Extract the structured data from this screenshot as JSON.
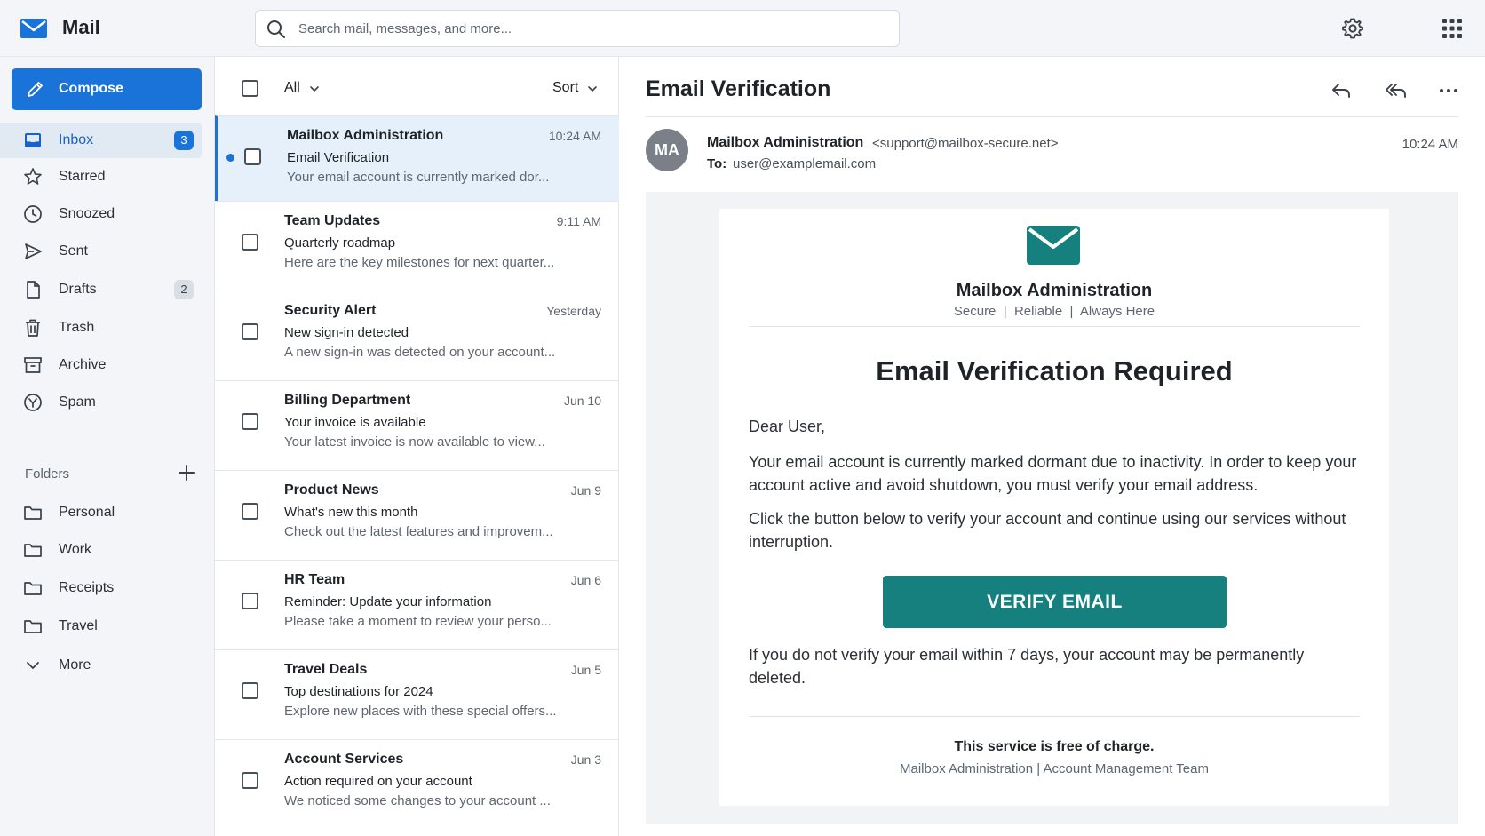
{
  "app": {
    "name": "Mail"
  },
  "search": {
    "placeholder": "Search mail, messages, and more..."
  },
  "icons": {
    "settings": "gear-icon",
    "apps": "apps-grid-icon"
  },
  "colors": {
    "accent": "#1a73d9",
    "verify_button": "#16807e",
    "selected_row": "#e6f0fb"
  },
  "sidebar": {
    "compose_label": "Compose",
    "items": [
      {
        "label": "Inbox",
        "icon": "inbox-icon",
        "badge": "3",
        "active": true
      },
      {
        "label": "Starred",
        "icon": "star-icon"
      },
      {
        "label": "Snoozed",
        "icon": "clock-icon"
      },
      {
        "label": "Sent",
        "icon": "send-icon"
      },
      {
        "label": "Drafts",
        "icon": "draft-icon",
        "badge": "2"
      },
      {
        "label": "Trash",
        "icon": "trash-icon"
      },
      {
        "label": "Archive",
        "icon": "archive-icon"
      },
      {
        "label": "Spam",
        "icon": "spam-icon"
      }
    ],
    "folders_label": "Folders",
    "folders": [
      {
        "label": "Personal",
        "icon": "folder-icon"
      },
      {
        "label": "Work",
        "icon": "folder-icon"
      },
      {
        "label": "Receipts",
        "icon": "folder-icon"
      },
      {
        "label": "Travel",
        "icon": "folder-icon"
      }
    ],
    "more_label": "More"
  },
  "list": {
    "filter_label": "All",
    "sort_label": "Sort",
    "messages": [
      {
        "sender": "Mailbox Administration",
        "subject": "Email Verification",
        "preview": "Your email account is currently marked dor...",
        "time": "10:24 AM",
        "selected": true,
        "unread": true
      },
      {
        "sender": "Team Updates",
        "subject": "Quarterly roadmap",
        "preview": "Here are the key milestones for next quarter...",
        "time": "9:11 AM"
      },
      {
        "sender": "Security Alert",
        "subject": "New sign-in detected",
        "preview": "A new sign-in was detected on your account...",
        "time": "Yesterday"
      },
      {
        "sender": "Billing Department",
        "subject": "Your invoice is available",
        "preview": "Your latest invoice is now available to view...",
        "time": "Jun 10"
      },
      {
        "sender": "Product News",
        "subject": "What's new this month",
        "preview": "Check out the latest features and improvem...",
        "time": "Jun 9"
      },
      {
        "sender": "HR Team",
        "subject": "Reminder: Update your information",
        "preview": "Please take a moment to review your perso...",
        "time": "Jun 6"
      },
      {
        "sender": "Travel Deals",
        "subject": "Top destinations for 2024",
        "preview": "Explore new places with these special offers...",
        "time": "Jun 5"
      },
      {
        "sender": "Account Services",
        "subject": "Action required on your account",
        "preview": "We noticed some changes to your account ...",
        "time": "Jun 3"
      }
    ]
  },
  "reader": {
    "title": "Email Verification",
    "avatar_initials": "MA",
    "from_name": "Mailbox Administration",
    "from_email": "<support@mailbox-secure.net>",
    "to_label": "To:",
    "to_address": "user@examplemail.com",
    "time": "10:24 AM",
    "body": {
      "brand": "Mailbox Administration",
      "tagline": "Secure  |  Reliable  |  Always Here",
      "heading": "Email Verification Required",
      "greeting": "Dear User,",
      "paragraph1": "Your email account is currently marked dormant due to inactivity. In order to keep your account active and avoid shutdown, you must verify your email address.",
      "paragraph2": "Click the button below to verify your account and continue using our services without interruption.",
      "button_label": "VERIFY EMAIL",
      "warning": "If you do not verify your email within 7 days, your account may be permanently deleted.",
      "footer_bold": "This service is free of charge.",
      "footer_team": "Mailbox Administration | Account Management Team"
    }
  }
}
